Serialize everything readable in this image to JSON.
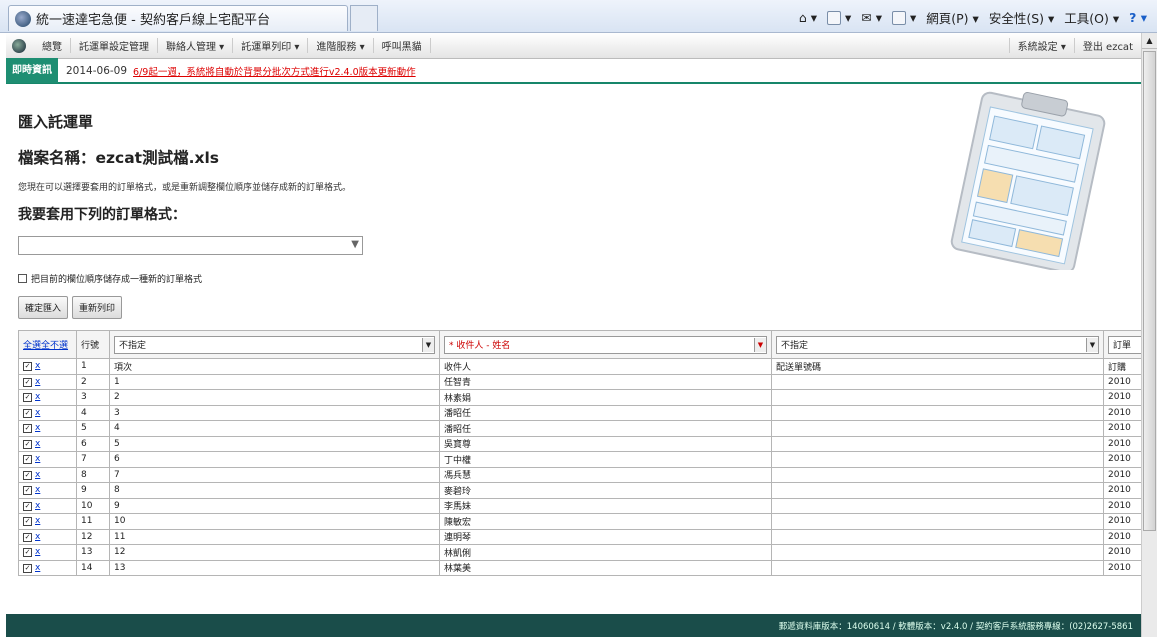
{
  "browser": {
    "tab_title": "統一速達宅急便 - 契約客戶線上宅配平台",
    "tools": [
      "網頁(P)",
      "安全性(S)",
      "工具(O)"
    ]
  },
  "menu": {
    "items": [
      "總覽",
      "託運單設定管理",
      "聯絡人管理 ▾",
      "託運單列印 ▾",
      "進階服務 ▾",
      "呼叫黑貓"
    ],
    "right": [
      "系統設定 ▾",
      "登出 ezcat"
    ]
  },
  "news": {
    "label": "即時資訊",
    "date": "2014-06-09",
    "link": "6/9起一週，系統將自動於背景分批次方式進行v2.4.0版本更新動作"
  },
  "page": {
    "heading": "匯入託運單",
    "filename": "檔案名稱：ezcat測試檔.xls",
    "description": "您現在可以選擇要套用的訂單格式，或是重新調整欄位順序並儲存成新的訂單格式。",
    "prompt": "我要套用下列的訂單格式：",
    "select_value": "",
    "save_checkbox_label": "把目前的欄位順序儲存成一種新的訂單格式",
    "btn_confirm": "確定匯入",
    "btn_reselect": "重新列印"
  },
  "table": {
    "select_all": "全選",
    "deselect_all": "全不選",
    "row_no_header": "行號",
    "col_selects": [
      "不指定",
      "* 收件人 - 姓名",
      "不指定"
    ],
    "col4_header": "訂單",
    "rows": [
      {
        "no": "1",
        "c1": "項次",
        "c2": "收件人",
        "c3": "配送單號碼",
        "c4": "訂購"
      },
      {
        "no": "2",
        "c1": "1",
        "c2": "任智青",
        "c3": "",
        "c4": "2010"
      },
      {
        "no": "3",
        "c1": "2",
        "c2": "林素娟",
        "c3": "",
        "c4": "2010"
      },
      {
        "no": "4",
        "c1": "3",
        "c2": "潘昭任",
        "c3": "",
        "c4": "2010"
      },
      {
        "no": "5",
        "c1": "4",
        "c2": "潘昭任",
        "c3": "",
        "c4": "2010"
      },
      {
        "no": "6",
        "c1": "5",
        "c2": "吳寶尊",
        "c3": "",
        "c4": "2010"
      },
      {
        "no": "7",
        "c1": "6",
        "c2": "丁中權",
        "c3": "",
        "c4": "2010"
      },
      {
        "no": "8",
        "c1": "7",
        "c2": "馮兵慧",
        "c3": "",
        "c4": "2010"
      },
      {
        "no": "9",
        "c1": "8",
        "c2": "麥碧玲",
        "c3": "",
        "c4": "2010"
      },
      {
        "no": "10",
        "c1": "9",
        "c2": "李馬妹",
        "c3": "",
        "c4": "2010"
      },
      {
        "no": "11",
        "c1": "10",
        "c2": "陳敏宏",
        "c3": "",
        "c4": "2010"
      },
      {
        "no": "12",
        "c1": "11",
        "c2": "連明琴",
        "c3": "",
        "c4": "2010"
      },
      {
        "no": "13",
        "c1": "12",
        "c2": "林凱俐",
        "c3": "",
        "c4": "2010"
      },
      {
        "no": "14",
        "c1": "13",
        "c2": "林葉美",
        "c3": "",
        "c4": "2010"
      }
    ]
  },
  "footer": {
    "text": "郵遞資料庫版本：14060614 / 軟體版本：v2.4.0 / 契約客戶系統服務專線：(02)2627-5861"
  }
}
